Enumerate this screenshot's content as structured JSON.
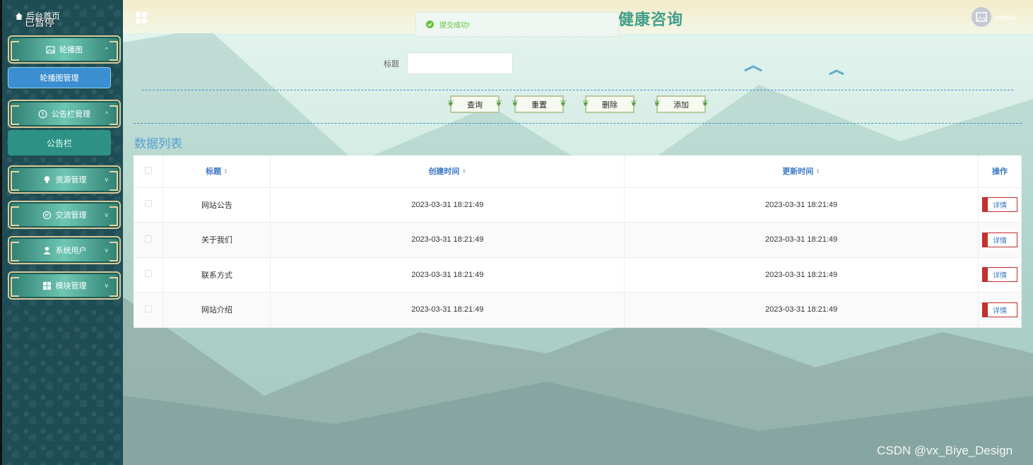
{
  "sidebar": {
    "home_label": "后台首页",
    "paused_label": "已暂停",
    "items": [
      {
        "label": "轮播图",
        "icon": "image-icon"
      },
      {
        "label": "公告栏管理",
        "icon": "info-icon"
      },
      {
        "label": "资源管理",
        "icon": "bulb-icon"
      },
      {
        "label": "交流管理",
        "icon": "chat-icon"
      },
      {
        "label": "系统用户",
        "icon": "user-icon"
      },
      {
        "label": "模块管理",
        "icon": "grid-icon"
      }
    ],
    "subitems": {
      "carousel_manage": "轮播图管理",
      "notice": "公告栏"
    }
  },
  "header": {
    "title": "健康咨询",
    "username": "admin"
  },
  "toast": {
    "message": "提交成功!"
  },
  "search": {
    "title_label": "标题",
    "title_value": ""
  },
  "buttons": {
    "query": "查询",
    "reset": "重置",
    "delete": "删除",
    "add": "添加"
  },
  "list": {
    "heading": "数据列表",
    "columns": {
      "title": "标题",
      "created": "创建时间",
      "updated": "更新时间",
      "action": "操作"
    },
    "detail_label": "详情",
    "rows": [
      {
        "title": "网站公告",
        "created": "2023-03-31 18:21:49",
        "updated": "2023-03-31 18:21:49"
      },
      {
        "title": "关于我们",
        "created": "2023-03-31 18:21:49",
        "updated": "2023-03-31 18:21:49"
      },
      {
        "title": "联系方式",
        "created": "2023-03-31 18:21:49",
        "updated": "2023-03-31 18:21:49"
      },
      {
        "title": "网站介绍",
        "created": "2023-03-31 18:21:49",
        "updated": "2023-03-31 18:21:49"
      }
    ]
  },
  "watermark": "CSDN @vx_Biye_Design",
  "colors": {
    "sidebar_bg": "#1f4d55",
    "accent": "#3a78c4",
    "success": "#67c23a"
  }
}
